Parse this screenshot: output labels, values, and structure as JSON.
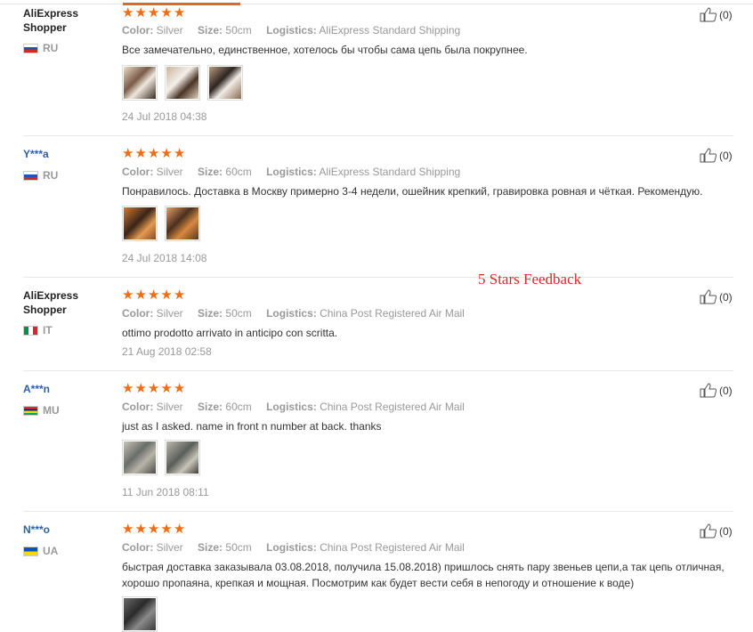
{
  "reviews": [
    {
      "user": "AliExpress Shopper",
      "country": "RU",
      "rating": 5,
      "color_label": "Color:",
      "color": "Silver",
      "size_label": "Size:",
      "size": "50cm",
      "logistics_label": "Logistics:",
      "logistics": "AliExpress Standard Shipping",
      "text": "Все замечательно, единственное, хотелось бы чтобы сама цепь была покрупнее.",
      "photos": 3,
      "date": "24 Jul 2018 04:38",
      "likes": "(0)"
    },
    {
      "user": "Y***a",
      "country": "RU",
      "rating": 5,
      "color_label": "Color:",
      "color": "Silver",
      "size_label": "Size:",
      "size": "60cm",
      "logistics_label": "Logistics:",
      "logistics": "AliExpress Standard Shipping",
      "text": "Понравилось. Доставка в Москву примерно 3-4 недели, ошейник крепкий, гравировка ровная и чёткая. Рекомендую.",
      "photos": 2,
      "date": "24 Jul 2018 14:08",
      "likes": "(0)"
    },
    {
      "user": "AliExpress Shopper",
      "country": "IT",
      "rating": 5,
      "color_label": "Color:",
      "color": "Silver",
      "size_label": "Size:",
      "size": "50cm",
      "logistics_label": "Logistics:",
      "logistics": "China Post Registered Air Mail",
      "text": "ottimo prodotto arrivato in anticipo con scritta.",
      "photos": 0,
      "date": "21 Aug 2018 02:58",
      "likes": "(0)"
    },
    {
      "user": "A***n",
      "country": "MU",
      "rating": 5,
      "color_label": "Color:",
      "color": "Silver",
      "size_label": "Size:",
      "size": "60cm",
      "logistics_label": "Logistics:",
      "logistics": "China Post Registered Air Mail",
      "text": "just as I asked. name in front n number at back. thanks",
      "photos": 2,
      "date": "11 Jun 2018 08:11",
      "likes": "(0)"
    },
    {
      "user": "N***o",
      "country": "UA",
      "rating": 5,
      "color_label": "Color:",
      "color": "Silver",
      "size_label": "Size:",
      "size": "50cm",
      "logistics_label": "Logistics:",
      "logistics": "China Post Registered Air Mail",
      "text": "быстрая доставка заказывала 03.08.2018, получила 15.08.2018) пришлось снять пару звеньев цепи,а так цепь отличная, хорошо пропаяна, крепкая и мощная. Посмотрим как будет вести себя в непогоду и отношение к воде)",
      "photos": 1,
      "date": "",
      "likes": "(0)"
    }
  ],
  "overlay_label": "5 Stars Feedback",
  "colors": {
    "star": "#f06c15",
    "masked_user": "#2b5fa8",
    "overlay": "#d42a2a",
    "accent": "#e4671a"
  },
  "icons": {
    "rating": "star-icon",
    "like": "thumbs-up-icon",
    "photo": "review-photo"
  }
}
